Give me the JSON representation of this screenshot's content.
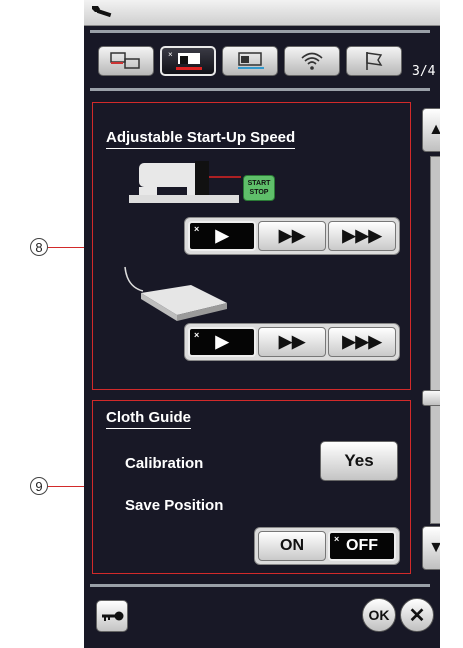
{
  "callouts": {
    "speed": "8",
    "cloth_guide": "9"
  },
  "header": {
    "icon": "wrench-icon"
  },
  "tabs": [
    {
      "name": "common-settings",
      "icon": "machine-pair-icon",
      "active": false
    },
    {
      "name": "sewing-settings",
      "icon": "sewing-machine-icon",
      "active": true
    },
    {
      "name": "embroidery-settings",
      "icon": "embroidery-machine-icon",
      "active": false
    },
    {
      "name": "wireless-settings",
      "icon": "wifi-icon",
      "active": false
    },
    {
      "name": "language-settings",
      "icon": "flag-icon",
      "active": false
    }
  ],
  "page_indicator": "3/4",
  "speed_section": {
    "title": "Adjustable Start-Up Speed",
    "start_stop_label_1": "START",
    "start_stop_label_2": "STOP",
    "machine_options": [
      "slow",
      "medium",
      "fast"
    ],
    "machine_selected": 0,
    "pedal_options": [
      "slow",
      "medium",
      "fast"
    ],
    "pedal_selected": 0
  },
  "cloth_guide": {
    "title": "Cloth Guide",
    "calibration_label": "Calibration",
    "calibration_button": "Yes",
    "save_position_label": "Save Position",
    "on_label": "ON",
    "off_label": "OFF",
    "selected": "OFF"
  },
  "footer": {
    "key_icon": "key-icon",
    "ok_label": "OK",
    "close_icon": "close-icon"
  },
  "colors": {
    "screen_bg": "#181826",
    "frame_red": "#d22a2a",
    "accent": "#e8e8e8"
  },
  "scrollbar": {
    "position": 0.6
  }
}
